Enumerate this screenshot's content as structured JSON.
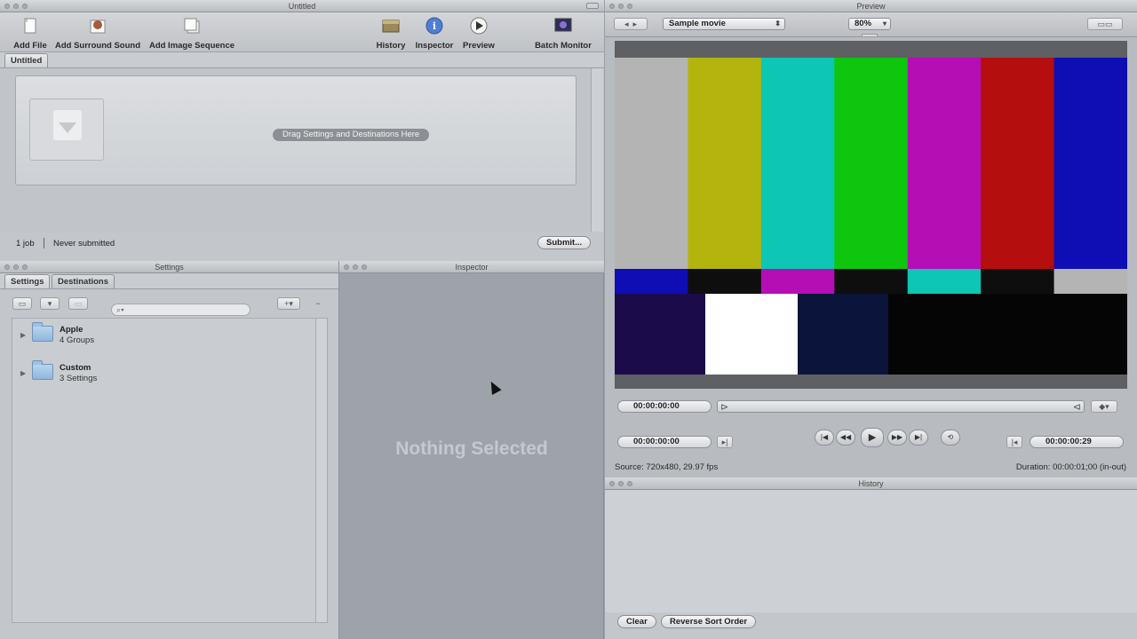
{
  "batch": {
    "title": "Untitled",
    "toolbar": {
      "add_file": "Add File",
      "add_surround": "Add Surround Sound",
      "add_sequence": "Add Image Sequence",
      "history": "History",
      "inspector": "Inspector",
      "preview": "Preview",
      "batch_monitor": "Batch Monitor"
    },
    "tab": "Untitled",
    "drop_hint": "Drag Settings and Destinations Here",
    "job_count": "1 job",
    "status": "Never submitted",
    "submit": "Submit..."
  },
  "settings": {
    "title": "Settings",
    "tabs": [
      "Settings",
      "Destinations"
    ],
    "search_placeholder": "",
    "items": [
      {
        "name": "Apple",
        "count": "4 Groups"
      },
      {
        "name": "Custom",
        "count": "3 Settings"
      }
    ]
  },
  "inspector": {
    "title": "Inspector",
    "empty": "Nothing Selected"
  },
  "preview": {
    "title": "Preview",
    "source_select": "Sample movie",
    "zoom": "80%",
    "timecode_scrub": "00:00:00:00",
    "timecode_in": "00:00:00:00",
    "timecode_out": "00:00:00:29",
    "source_info": "Source: 720x480, 29.97 fps",
    "duration": "Duration: 00:00:01;00 (in-out)"
  },
  "history": {
    "title": "History",
    "clear": "Clear",
    "reverse": "Reverse Sort Order"
  },
  "colors": {
    "bars_top": [
      "#b4b4b4",
      "#b4b40e",
      "#0ec6b4",
      "#0ec60e",
      "#b40eb4",
      "#b40e0e",
      "#0e0eb4"
    ],
    "bars_mid": [
      "#0e0eb4",
      "#0e0e0e",
      "#b40eb4",
      "#0e0e0e",
      "#0ec6b4",
      "#0e0e0e",
      "#b4b4b4"
    ],
    "bars_low": [
      "#1c0b4a",
      "#ffffff",
      "#0b143a",
      "#050505"
    ]
  }
}
